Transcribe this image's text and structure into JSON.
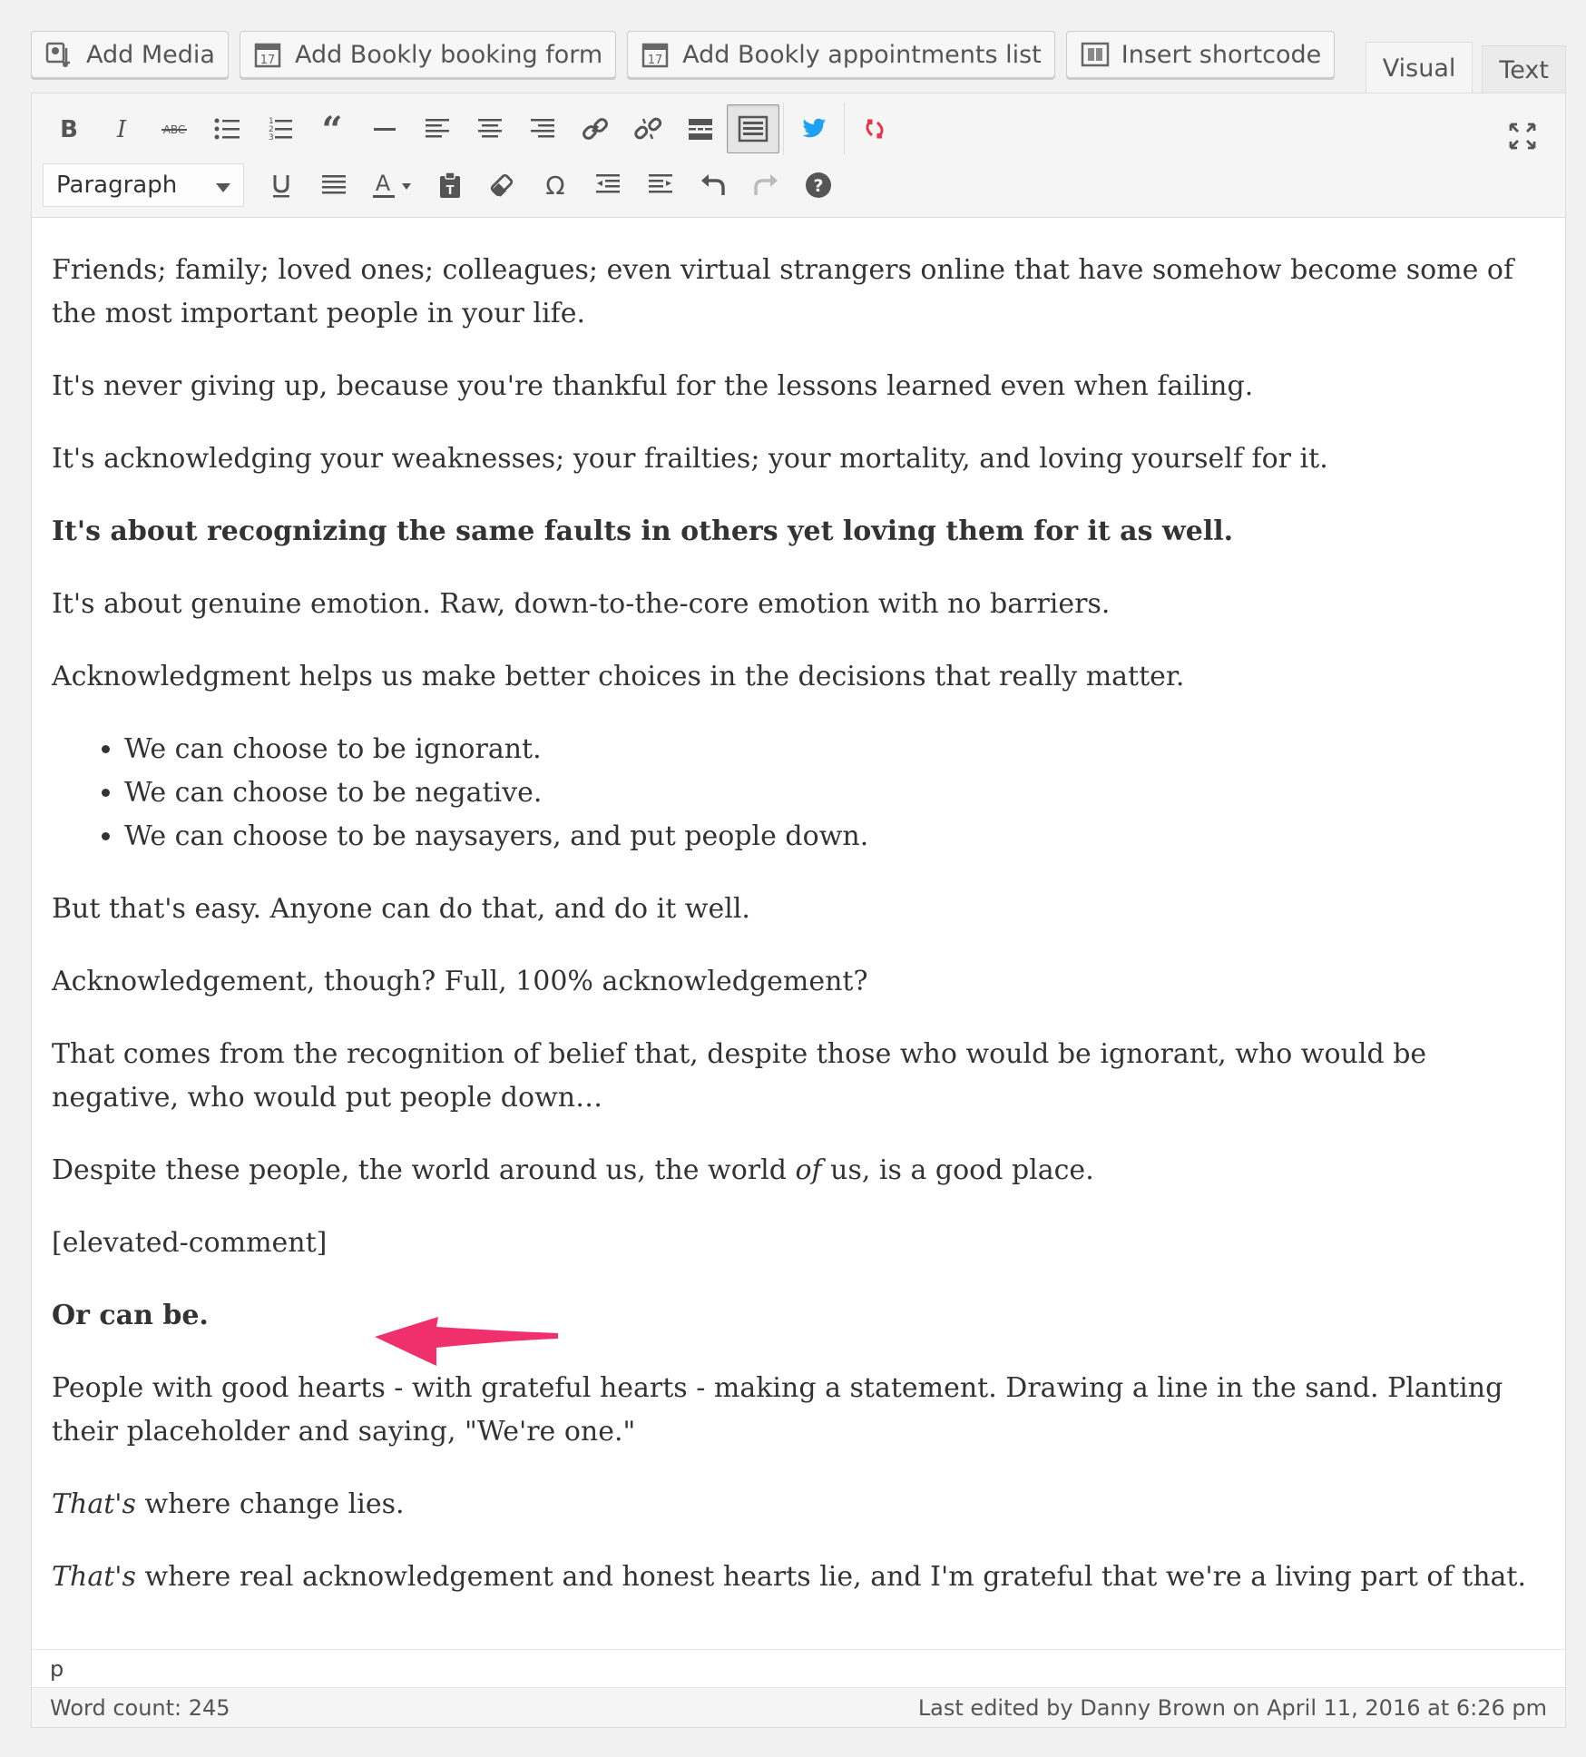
{
  "media_buttons": {
    "add_media": "Add Media",
    "add_bookly_form": "Add Bookly booking form",
    "add_bookly_list": "Add Bookly appointments list",
    "insert_shortcode": "Insert shortcode"
  },
  "calendar_icon_day": "17",
  "tabs": {
    "visual": "Visual",
    "text": "Text"
  },
  "format_select": {
    "value": "Paragraph"
  },
  "content": {
    "p1": "Friends; family; loved ones; colleagues; even virtual strangers online that have somehow become some of the most important people in your life.",
    "p2": "It's never giving up, because you're thankful for the lessons learned even when failing.",
    "p3": "It's acknowledging your weaknesses; your frailties; your mortality, and loving yourself for it.",
    "p4": "It's about recognizing the same faults in others yet loving them for it as well.",
    "p5": "It's about genuine emotion. Raw, down-to-the-core emotion with no barriers.",
    "p6": "Acknowledgment helps us make better choices in the decisions that really matter.",
    "list": [
      "We can choose to be ignorant.",
      "We can choose to be negative.",
      "We can choose to be naysayers, and put people down."
    ],
    "p7": "But that's easy. Anyone can do that, and do it well.",
    "p8": "Acknowledgement, though? Full, 100% acknowledgement?",
    "p9": "That comes from the recognition of belief that, despite those who would be ignorant, who would be negative, who would put people down…",
    "p10_a": "Despite these people, the world around us, the world ",
    "p10_em": "of",
    "p10_b": " us, is a good place.",
    "p11": "[elevated-comment]",
    "p12": "Or can be.",
    "p13": "People with good hearts - with grateful hearts - making a statement. Drawing a line in the sand. Planting their placeholder and saying, \"We're one.\"",
    "p14_em": "That's",
    "p14_b": " where change lies.",
    "p15_em": "That's",
    "p15_b": " where real acknowledgement and honest hearts lie, and I'm grateful that we're a living part of that."
  },
  "path": "p",
  "word_count": "Word count: 245",
  "last_edited": "Last edited by Danny Brown on April 11, 2016 at 6:26 pm",
  "colors": {
    "twitter": "#1da1f2",
    "accent_pink": "#f0306c",
    "pink_icon": "#e8334a"
  }
}
